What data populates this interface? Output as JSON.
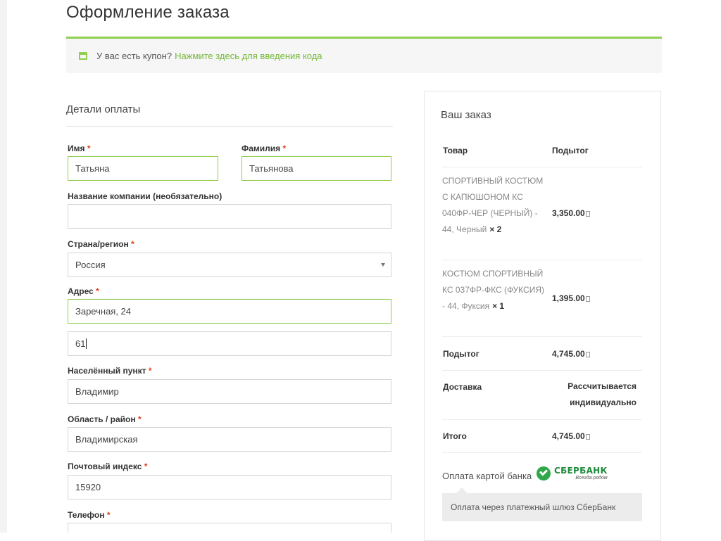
{
  "page": {
    "title": "Оформление заказа"
  },
  "coupon": {
    "text": "У вас есть купон?",
    "link": "Нажмите здесь для введения кода",
    "accent": "#8fce4e"
  },
  "billing": {
    "title": "Детали оплаты",
    "required_mark": "*",
    "first_name": {
      "label": "Имя",
      "value": "Татьяна"
    },
    "last_name": {
      "label": "Фамилия",
      "value": "Татьянова"
    },
    "company": {
      "label": "Название компании (необязательно)",
      "value": ""
    },
    "country": {
      "label": "Страна/регион",
      "value": "Россия"
    },
    "address": {
      "label": "Адрес",
      "value": "Заречная, 24",
      "value2": "61"
    },
    "city": {
      "label": "Населённый пункт",
      "value": "Владимир"
    },
    "state": {
      "label": "Область / район",
      "value": "Владимирская"
    },
    "postcode": {
      "label": "Почтовый индекс",
      "value": "15920"
    },
    "phone": {
      "label": "Телефон"
    }
  },
  "order": {
    "title": "Ваш заказ",
    "col_product": "Товар",
    "col_subtotal": "Подытог",
    "items": [
      {
        "name": "Спортивный костюм с капюшоном КС 040ФР-ЧЕР (ЧЕРНЫЙ) -",
        "variant": "44, Черный",
        "qty": "× 2",
        "total": "3,350.00"
      },
      {
        "name": "Костюм спортивный КС 037ФР-ФКС (ФУКСИЯ) -",
        "variant": "44, Фуксия",
        "qty": "× 1",
        "total": "1,395.00"
      }
    ],
    "subtotal_label": "Подытог",
    "subtotal_value": "4,745.00",
    "shipping_label": "Доставка",
    "shipping_value": "Рассчитывается индивидуально",
    "total_label": "Итого",
    "total_value": "4,745.00"
  },
  "payment": {
    "method_label": "Оплата картой банка",
    "logo_name": "СБЕРБАНК",
    "logo_tagline": "Всегда рядом",
    "description": "Оплата через платежный шлюз СберБанк"
  }
}
